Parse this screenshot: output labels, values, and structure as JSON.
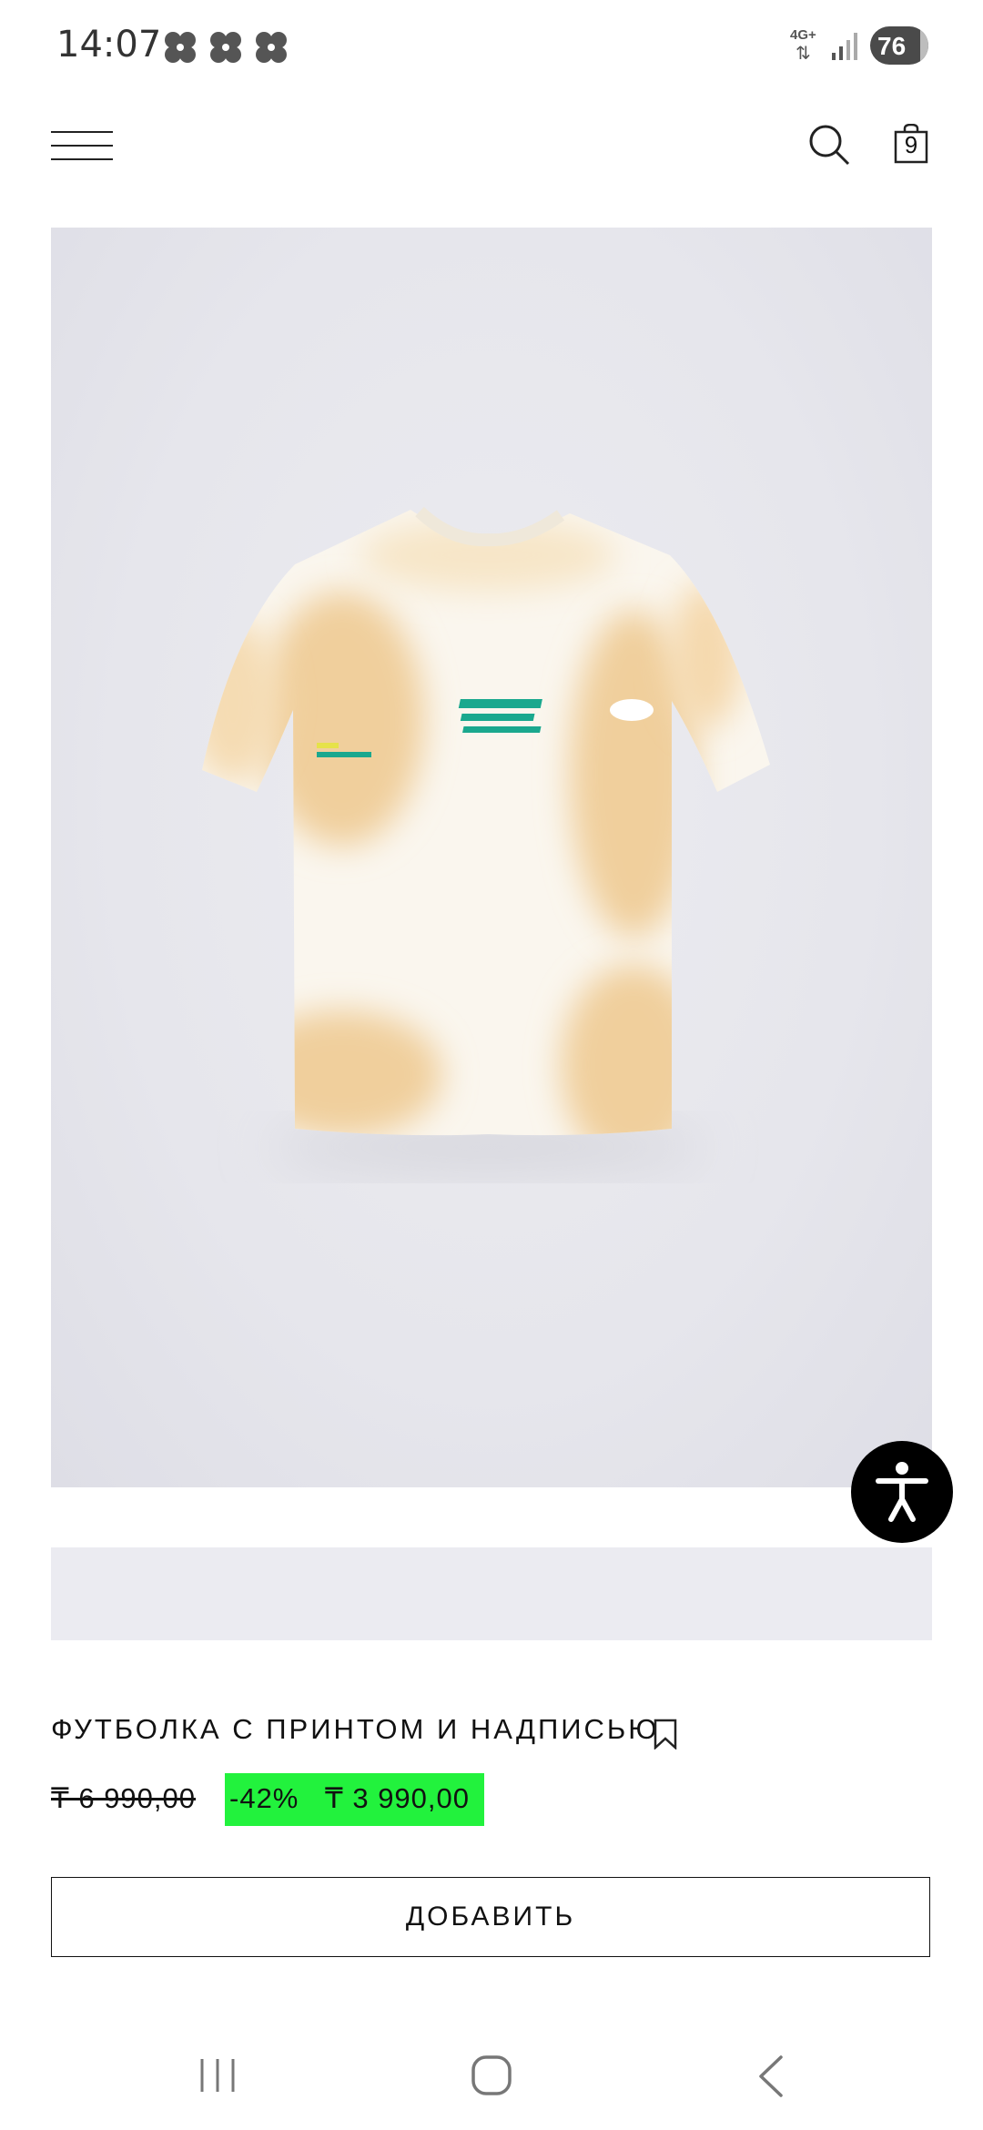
{
  "status_bar": {
    "time": "14:07",
    "network": "4G+",
    "battery": "76"
  },
  "header": {
    "menu_icon": "hamburger-icon",
    "search_icon": "search-icon",
    "bag_count": "9"
  },
  "product": {
    "image_background": "#e8e8ee",
    "title": "ФУТБОЛКА С ПРИНТОМ И НАДПИСЬЮ",
    "old_price": "₸ 6 990,00",
    "discount": "-42%",
    "new_price": "₸ 3 990,00",
    "sale_color": "#22f23d",
    "add_button": "ДОБАВИТЬ"
  },
  "accessibility": {
    "icon": "accessibility-icon"
  },
  "nav_bar": {
    "recent_icon": "recent-apps-icon",
    "home_icon": "home-icon",
    "back_icon": "back-icon"
  }
}
